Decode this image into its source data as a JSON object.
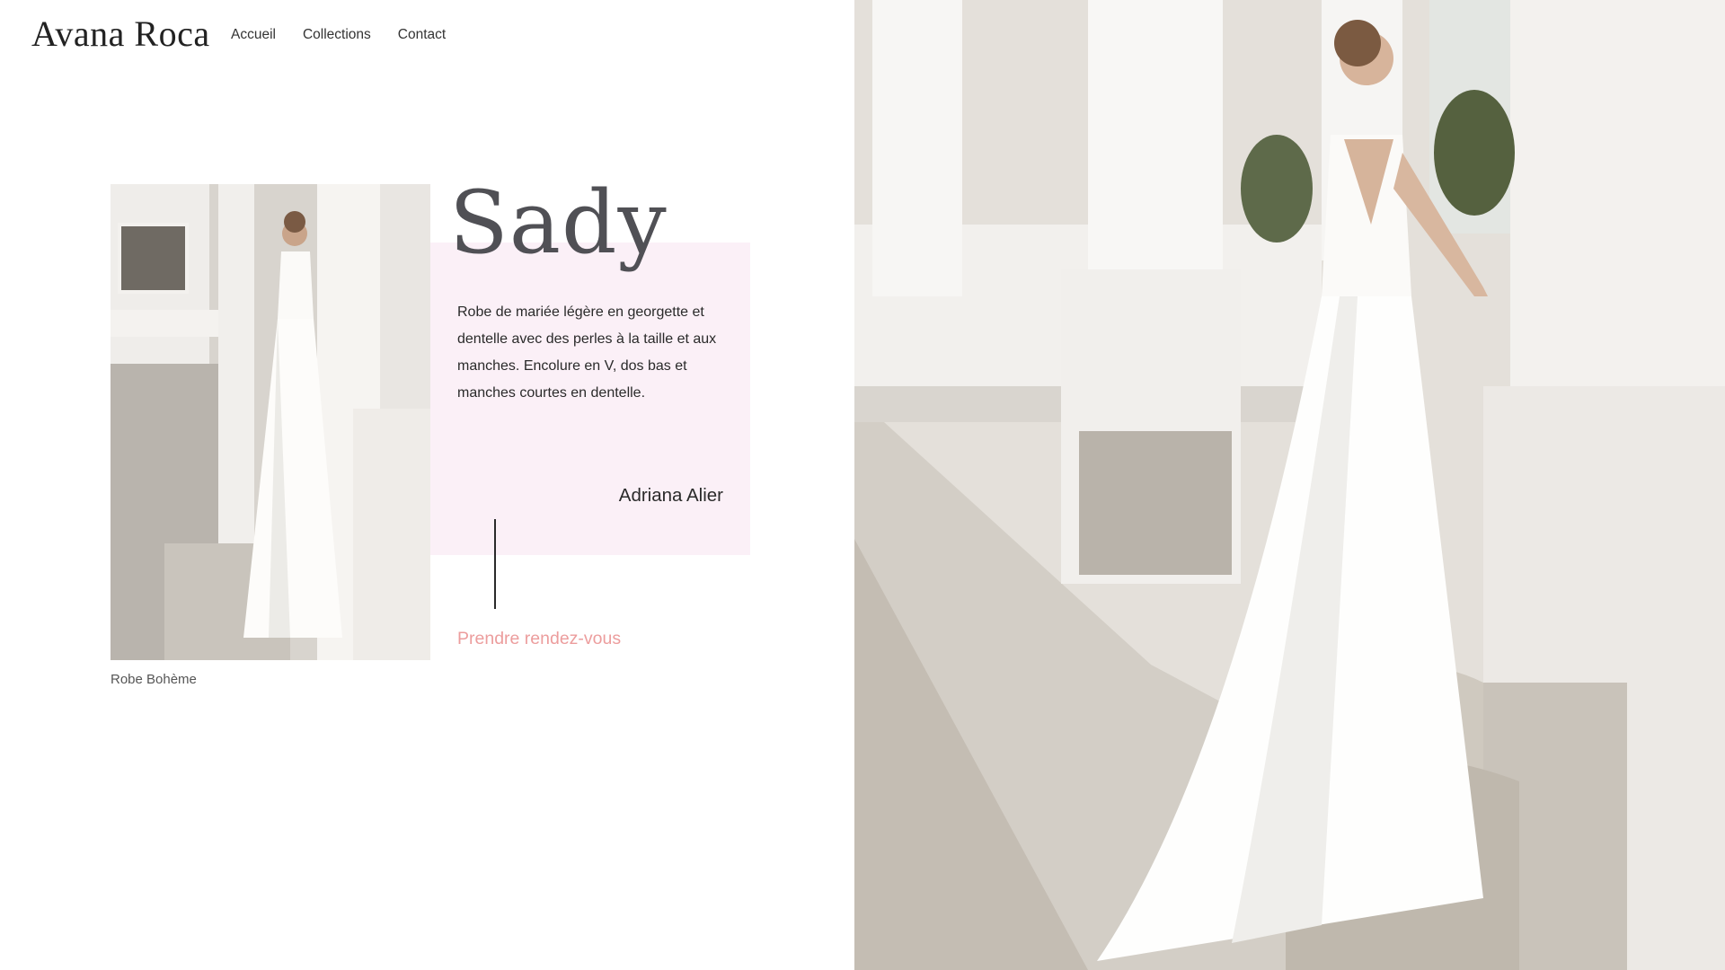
{
  "brand": {
    "name": "Avana Roca"
  },
  "nav": {
    "items": [
      "Accueil",
      "Collections",
      "Contact"
    ]
  },
  "product": {
    "name": "Sady",
    "description": "Robe de mariée légère en georgette et dentelle avec des perles à la taille et aux manches. Encolure en V, dos bas et manches courtes en dentelle.",
    "designer": "Adriana Alier",
    "cta_label": "Prendre rendez-vous",
    "image_caption": "Robe Bohème"
  },
  "colors": {
    "accent": "#ec9d9d",
    "card_background": "#fbf0f7",
    "title": "#505055"
  }
}
